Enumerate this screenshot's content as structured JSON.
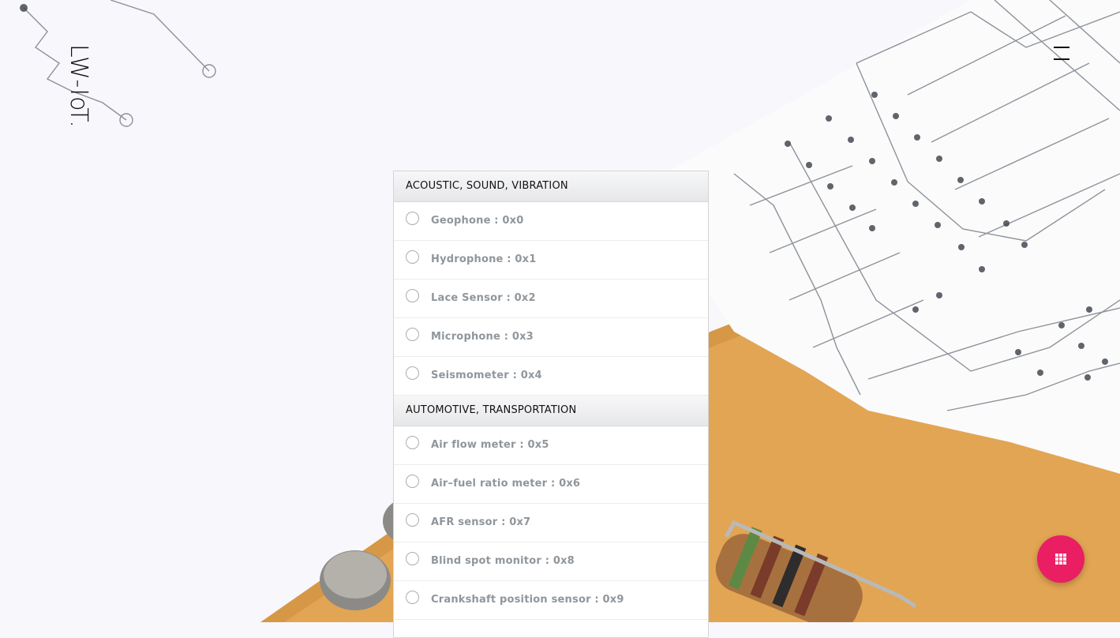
{
  "brand": {
    "logo_text": "LW-IoT."
  },
  "menu": {
    "icon": "hamburger-menu-icon"
  },
  "groups": [
    {
      "title": "ACOUSTIC, SOUND, VIBRATION",
      "options": [
        {
          "label": "Geophone : 0x0",
          "selected": false
        },
        {
          "label": "Hydrophone : 0x1",
          "selected": false
        },
        {
          "label": "Lace Sensor : 0x2",
          "selected": false
        },
        {
          "label": "Microphone : 0x3",
          "selected": false
        },
        {
          "label": "Seismometer : 0x4",
          "selected": false
        }
      ]
    },
    {
      "title": "AUTOMOTIVE, TRANSPORTATION",
      "options": [
        {
          "label": "Air flow meter : 0x5",
          "selected": false
        },
        {
          "label": "Air–fuel ratio meter : 0x6",
          "selected": false
        },
        {
          "label": "AFR sensor : 0x7",
          "selected": false
        },
        {
          "label": "Blind spot monitor : 0x8",
          "selected": false
        },
        {
          "label": "Crankshaft position sensor : 0x9",
          "selected": false
        }
      ]
    }
  ],
  "fab": {
    "icon": "apps-grid-icon",
    "color": "#e91e63"
  },
  "colors": {
    "accent": "#e91e63",
    "page_background": "#f8f7fc",
    "board": "#e4a95a"
  }
}
